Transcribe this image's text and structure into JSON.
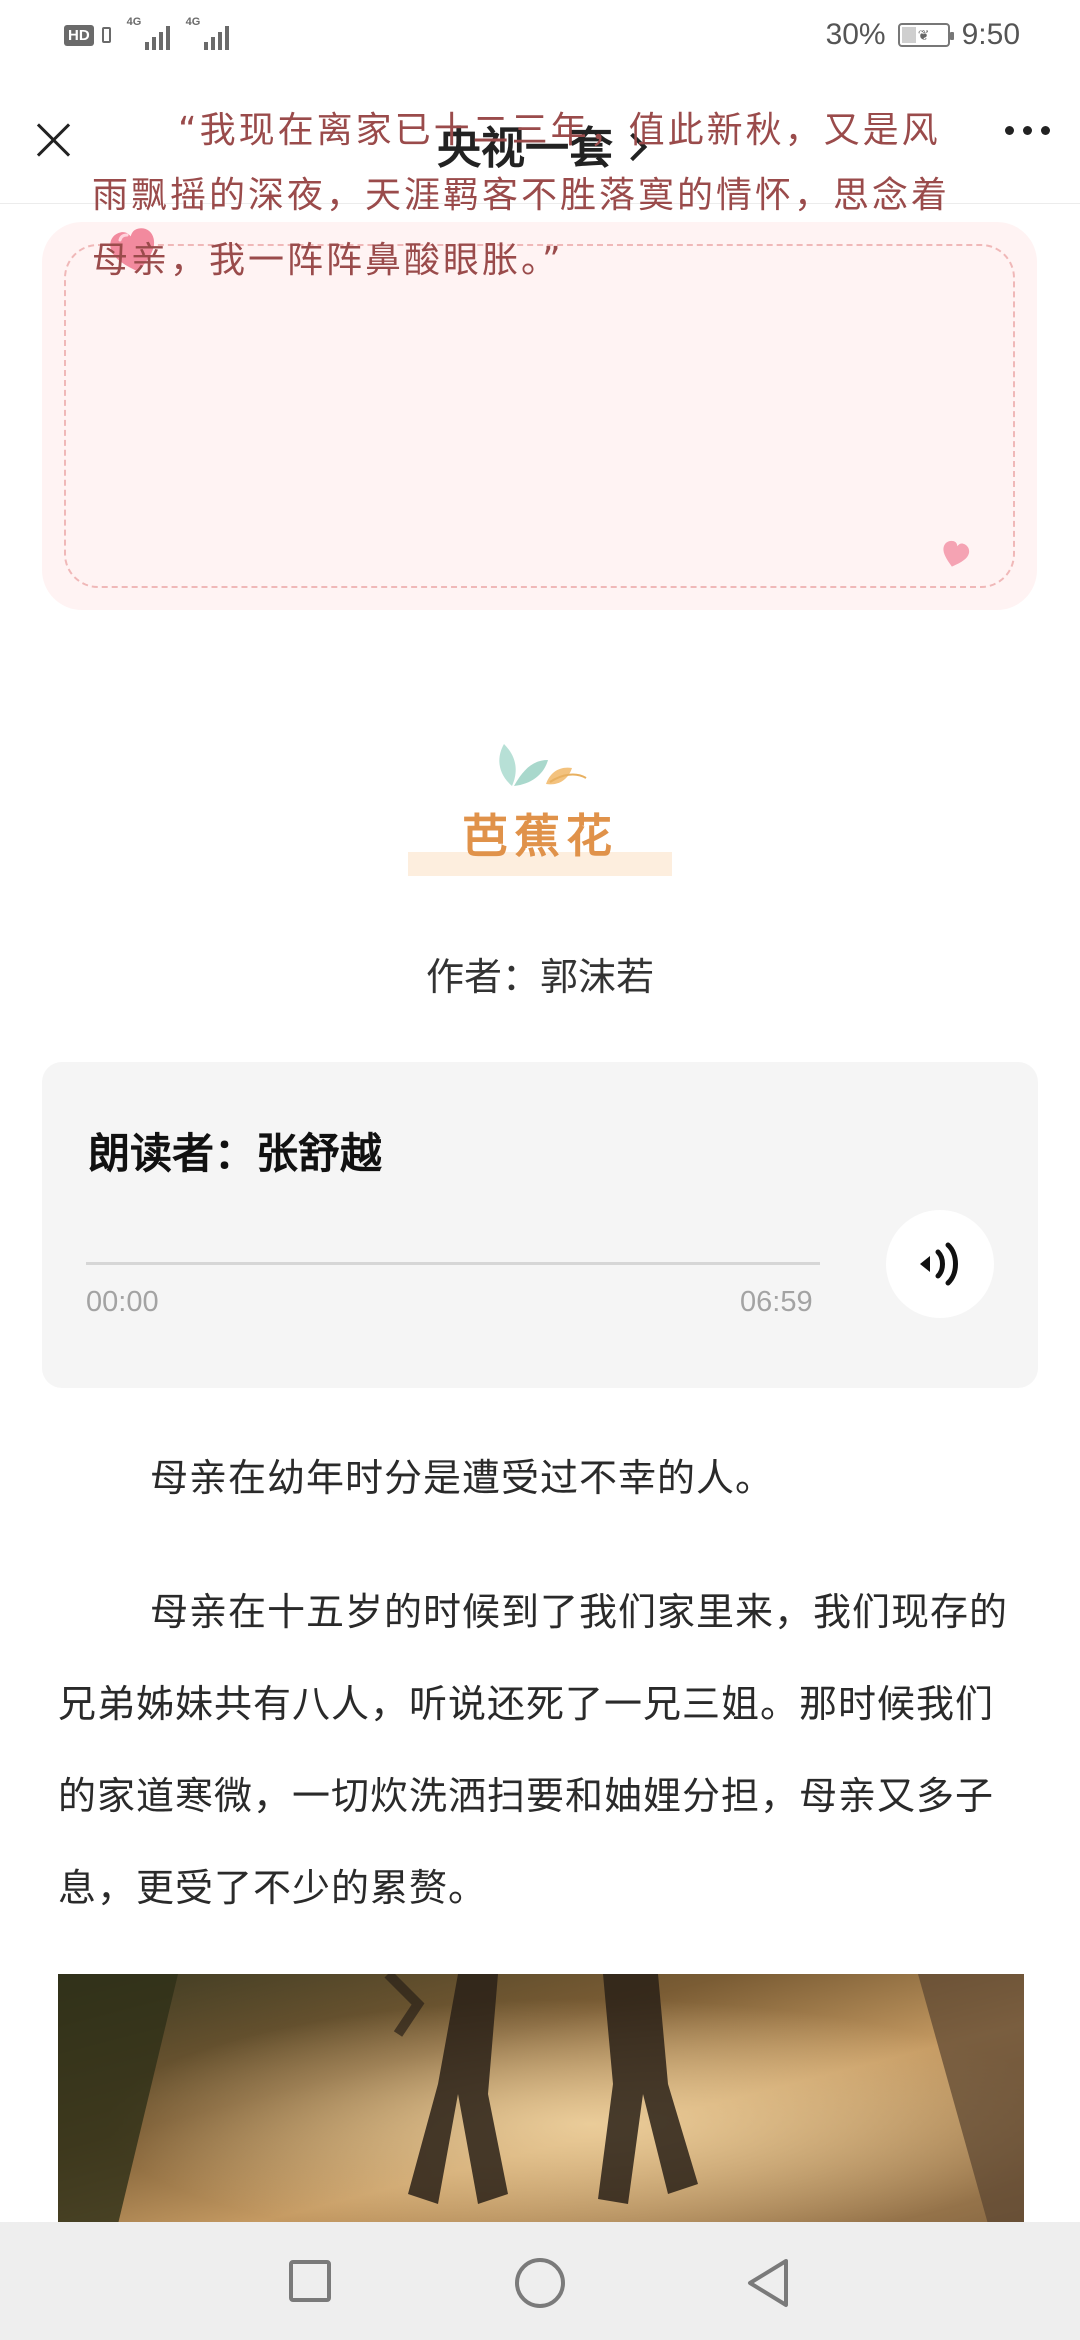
{
  "status_bar": {
    "hd": "HD",
    "network_1": "4G",
    "network_2": "4G",
    "battery_pct": "30%",
    "battery_level": 0.3,
    "time": "9:50"
  },
  "nav": {
    "title": "央视一套"
  },
  "quote": {
    "text": "“我现在离家已十二三年，值此新秋，又是风雨飘摇的深夜，天涯羁客不胜落寞的情怀，思念着母亲，我一阵阵鼻酸眼胀。”"
  },
  "poem": {
    "title": "芭蕉花",
    "author": "作者：郭沫若"
  },
  "audio": {
    "reader": "朗读者：张舒越",
    "current_time": "00:00",
    "total_time": "06:59",
    "progress": 0
  },
  "article": {
    "paragraphs": [
      "母亲在幼年时分是遭受过不幸的人。",
      "母亲在十五岁的时候到了我们家里来，我们现存的兄弟姊妹共有八人，听说还死了一兄三姐。那时候我们的家道寒微，一切炊洗洒扫要和妯娌分担，母亲又多子息，更受了不少的累赘。"
    ]
  },
  "colors": {
    "quote_bg": "#fff3f3",
    "quote_text": "#9a4b4b",
    "title_orange": "#e0924a",
    "audio_bg": "#f5f5f5"
  },
  "icons": {
    "close": "close-icon",
    "more": "more-icon",
    "audio": "speaker-icon",
    "nav_recent": "square-icon",
    "nav_home": "circle-icon",
    "nav_back": "triangle-back-icon"
  }
}
